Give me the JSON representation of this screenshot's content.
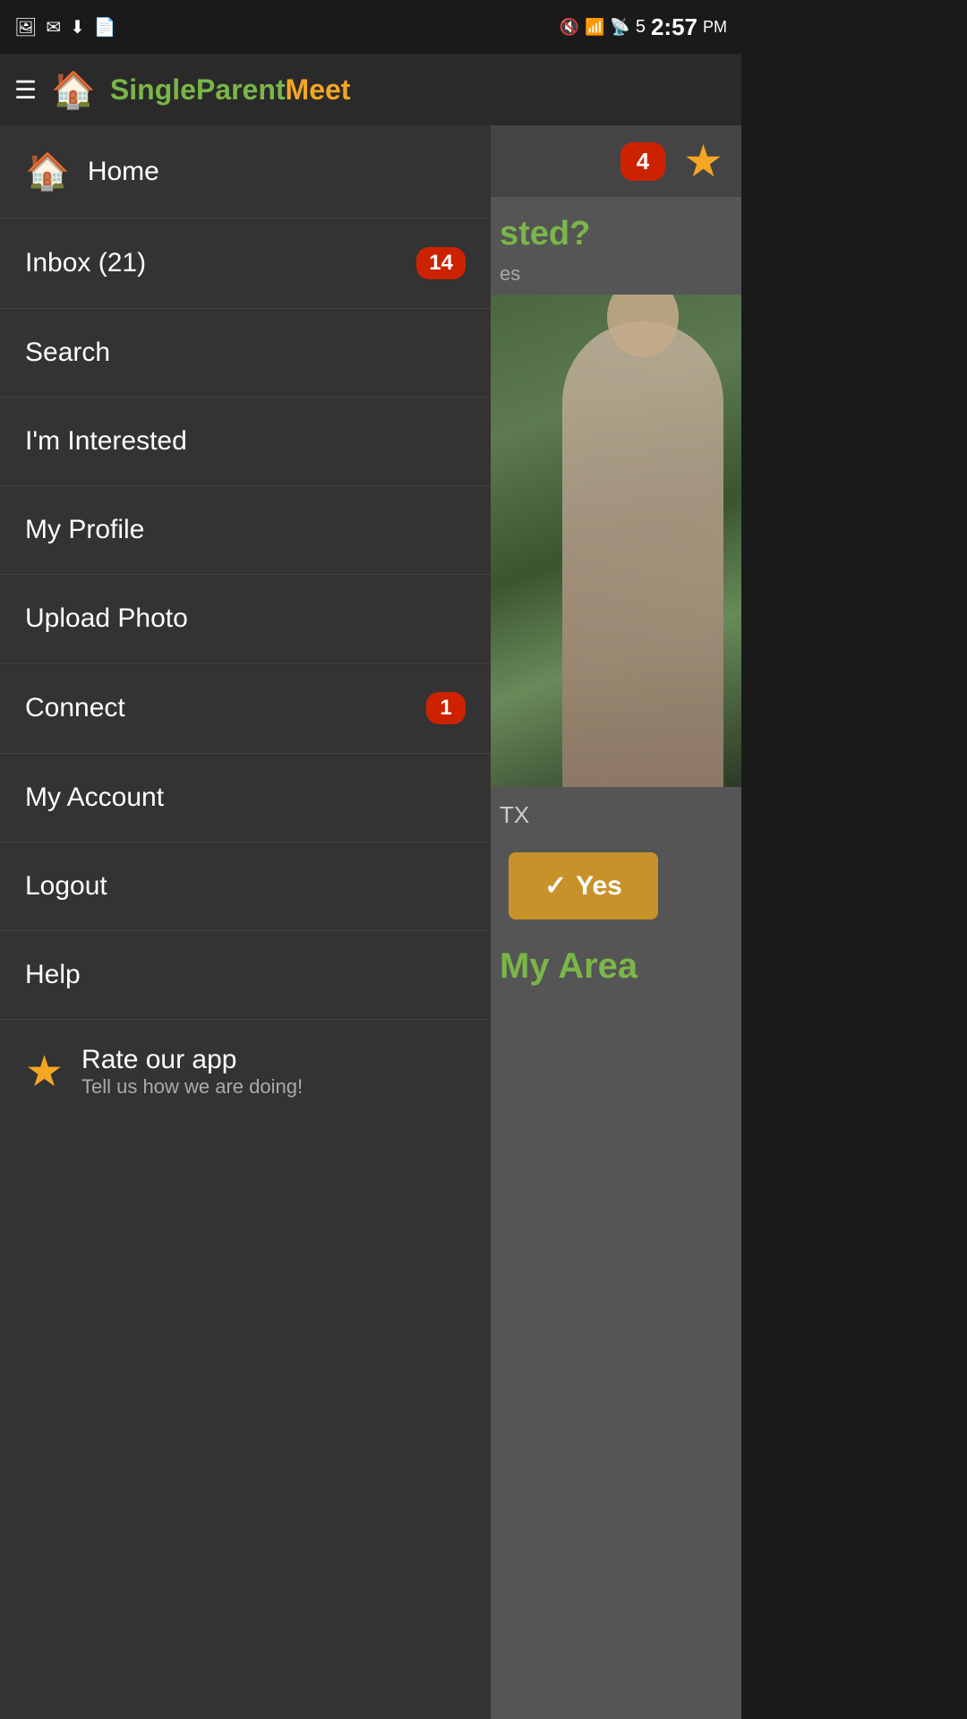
{
  "statusBar": {
    "time": "2:57",
    "ampm": "PM",
    "icons": [
      "image-icon",
      "mail-icon",
      "download-icon",
      "file-icon",
      "mute-icon",
      "wifi-icon",
      "signal-icon",
      "battery-icon"
    ]
  },
  "header": {
    "appName": {
      "part1": "SingleParent",
      "part2": "Meet"
    }
  },
  "sidebar": {
    "items": [
      {
        "id": "home",
        "label": "Home",
        "icon": "home",
        "badge": null
      },
      {
        "id": "inbox",
        "label": "Inbox (21)",
        "badge": "14"
      },
      {
        "id": "search",
        "label": "Search",
        "badge": null
      },
      {
        "id": "interested",
        "label": "I'm Interested",
        "badge": null
      },
      {
        "id": "profile",
        "label": "My Profile",
        "badge": null
      },
      {
        "id": "upload",
        "label": "Upload Photo",
        "badge": null
      },
      {
        "id": "connect",
        "label": "Connect",
        "badge": "1"
      },
      {
        "id": "account",
        "label": "My Account",
        "badge": null
      },
      {
        "id": "logout",
        "label": "Logout",
        "badge": null
      },
      {
        "id": "help",
        "label": "Help",
        "badge": null
      }
    ],
    "rateApp": {
      "title": "Rate our app",
      "subtitle": "Tell us how we are doing!"
    }
  },
  "rightContent": {
    "tabBadge": "4",
    "interestedQuestion": "sted?",
    "interestedSub": "es",
    "locationText": "TX",
    "yesButton": "Yes",
    "myAreaText": "My Area"
  }
}
